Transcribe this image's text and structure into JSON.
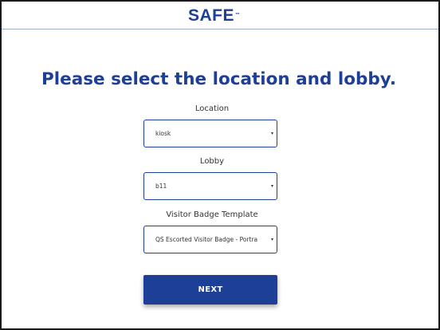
{
  "header": {
    "logo_text": "SAFE",
    "logo_mark": "™"
  },
  "page": {
    "title": "Please select the location and lobby."
  },
  "form": {
    "location": {
      "label": "Location",
      "value": "kiosk"
    },
    "lobby": {
      "label": "Lobby",
      "value": "b11"
    },
    "badge_template": {
      "label": "Visitor Badge Template",
      "value": "QS Escorted Visitor Badge - Portra"
    },
    "next_label": "NEXT",
    "caret_glyph": "▾"
  },
  "colors": {
    "brand_blue": "#1e3f96",
    "text": "#333333",
    "background": "#ffffff"
  }
}
